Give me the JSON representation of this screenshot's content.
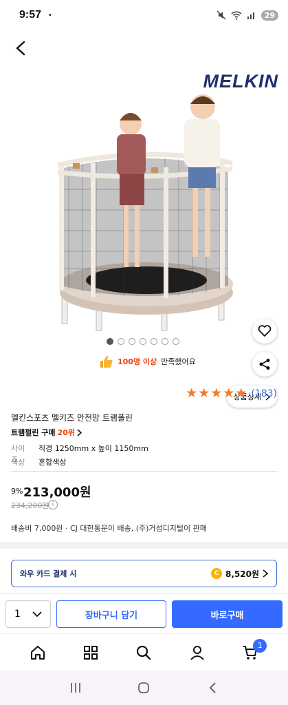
{
  "status_bar": {
    "time": "9:57",
    "dot": "•",
    "battery": "29"
  },
  "hero": {
    "brand": "MELKIN",
    "total_images": 7,
    "active_image": 0,
    "detail_button": "상품상세"
  },
  "satisfaction": {
    "highlight": "100명 이상",
    "rest": "만족했어요"
  },
  "rating": {
    "stars": 5,
    "count": "(183)"
  },
  "product": {
    "title": "멜킨스포츠 멜키즈 안전망 트램폴린",
    "rank_label": "트램펄린 구매",
    "rank_value": "20위",
    "size_label": "사이즈",
    "size_value": "직경 1250mm x 높이 1150mm",
    "color_label": "색상",
    "color_value": "혼합색상"
  },
  "price": {
    "discount": "9%",
    "sale": "213,000원",
    "original": "234,200원",
    "info_icon": "i"
  },
  "shipping": "배송비 7,000원 · CJ 대한통운이 배송, (주)거성디지털이 판매",
  "wow_card": {
    "label": "와우 카드 결제 시",
    "coin": "C",
    "amount": "8,520원"
  },
  "action_bar": {
    "quantity": "1",
    "cart": "장바구니 담기",
    "buy": "바로구매"
  },
  "nav": {
    "cart_badge": "1"
  },
  "colors": {
    "accent": "#346aff",
    "rank": "#e8430c",
    "star": "#f47b2a",
    "brand": "#1f2f6b"
  }
}
